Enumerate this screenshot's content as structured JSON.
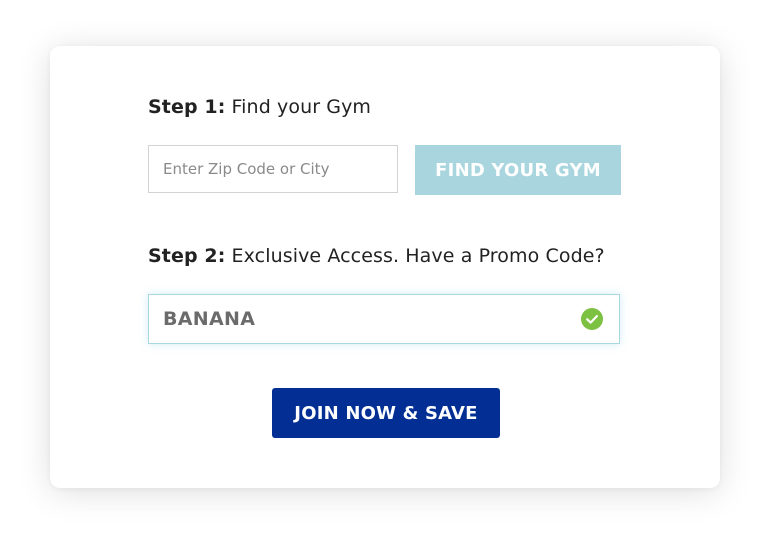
{
  "step1": {
    "number": "Step 1:",
    "title": "Find your Gym"
  },
  "zip_input": {
    "placeholder": "Enter Zip Code or City",
    "value": ""
  },
  "find_button": {
    "label": "FIND YOUR GYM",
    "color": "#a8d5de"
  },
  "step2": {
    "number": "Step 2:",
    "title": "Exclusive Access. Have a Promo Code?"
  },
  "promo_input": {
    "value": "BANANA",
    "status_icon": "check-circle-icon",
    "status_color": "#7dc142"
  },
  "join_button": {
    "label": "JOIN NOW & SAVE",
    "color": "#032f95"
  }
}
